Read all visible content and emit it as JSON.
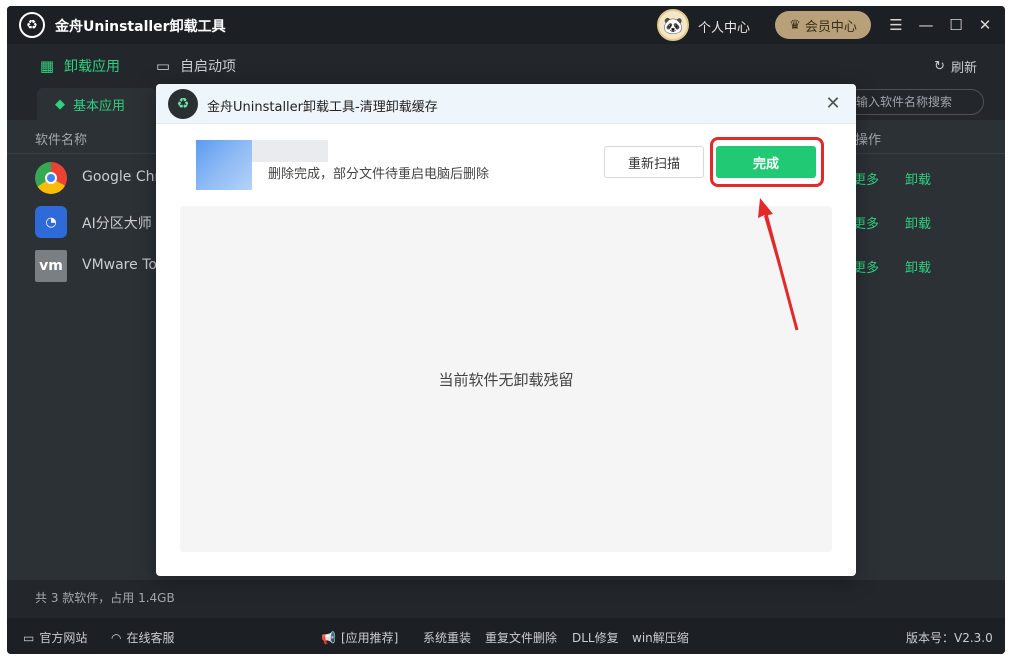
{
  "app": {
    "title": "金舟Uninstaller卸载工具",
    "user_center": "个人中心",
    "vip_label": "会员中心",
    "menu_icon": "hamburger-icon",
    "minimize_icon": "minimize-icon",
    "maximize_icon": "maximize-icon",
    "close_icon": "close-icon"
  },
  "nav": {
    "uninstall": "卸载应用",
    "startup": "自启动项",
    "refresh": "刷新"
  },
  "tabs": {
    "basic": "基本应用",
    "search_placeholder": "输入软件名称搜索"
  },
  "list": {
    "col_name": "软件名称",
    "col_ops": "操作",
    "rows": [
      {
        "name": "Google Chr",
        "more": "更多",
        "uninstall": "卸载",
        "icon": "chrome-icon"
      },
      {
        "name": "AI分区大师",
        "more": "更多",
        "uninstall": "卸载",
        "icon": "ai-partition-icon"
      },
      {
        "name": "VMware To",
        "more": "更多",
        "uninstall": "卸载",
        "icon": "vmware-icon"
      }
    ]
  },
  "status": "共 3 款软件，占用 1.4GB",
  "footer": {
    "website": "官方网站",
    "support": "在线客服",
    "recommend": "[应用推荐]",
    "links": [
      "系统重装",
      "重复文件删除",
      "DLL修复",
      "win解压缩"
    ],
    "version": "版本号：V2.3.0"
  },
  "dialog": {
    "title": "金舟Uninstaller卸载工具-清理卸载缓存",
    "status_message": "删除完成，部分文件待重启电脑后删除",
    "rescan_label": "重新扫描",
    "done_label": "完成",
    "empty_message": "当前软件无卸载残留"
  },
  "colors": {
    "accent_green": "#22c974",
    "highlight_red": "#e32929",
    "dark_bg": "#23272b"
  }
}
